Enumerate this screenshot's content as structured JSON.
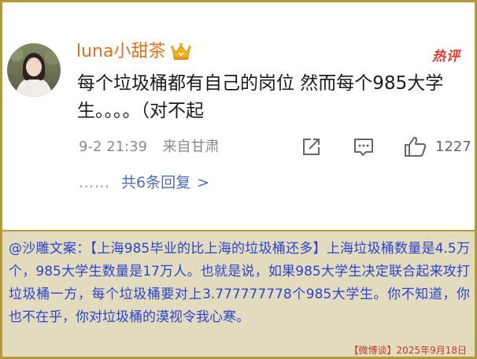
{
  "post": {
    "username": "luna小甜茶",
    "hot_badge": "热评",
    "text": "每个垃圾桶都有自己的岗位 然而每个985大学生。。。。（对不起",
    "time": "9-2 21:39",
    "location": "来自甘肃",
    "like_count": "1227",
    "replies_dots": "……",
    "replies_label": "共6条回复",
    "replies_chevron": ">",
    "accent": "#e96e1c",
    "link_color": "#4a6faf"
  },
  "caption": {
    "text": "@沙雕文案：【上海985毕业的比上海的垃圾桶还多】上海垃圾桶数量是4.5万个，985大学生数量是17万人。也就是说，如果985大学生决定联合起来攻打垃圾桶一方，每个垃圾桶要对上3.777777778个985大学生。你不知道，你也不在乎，你对垃圾桶的漠视令我心寒。",
    "footer": "【微博谈】2025年9月18日",
    "text_color": "#2a45d0",
    "background": "#e3dbbd"
  }
}
